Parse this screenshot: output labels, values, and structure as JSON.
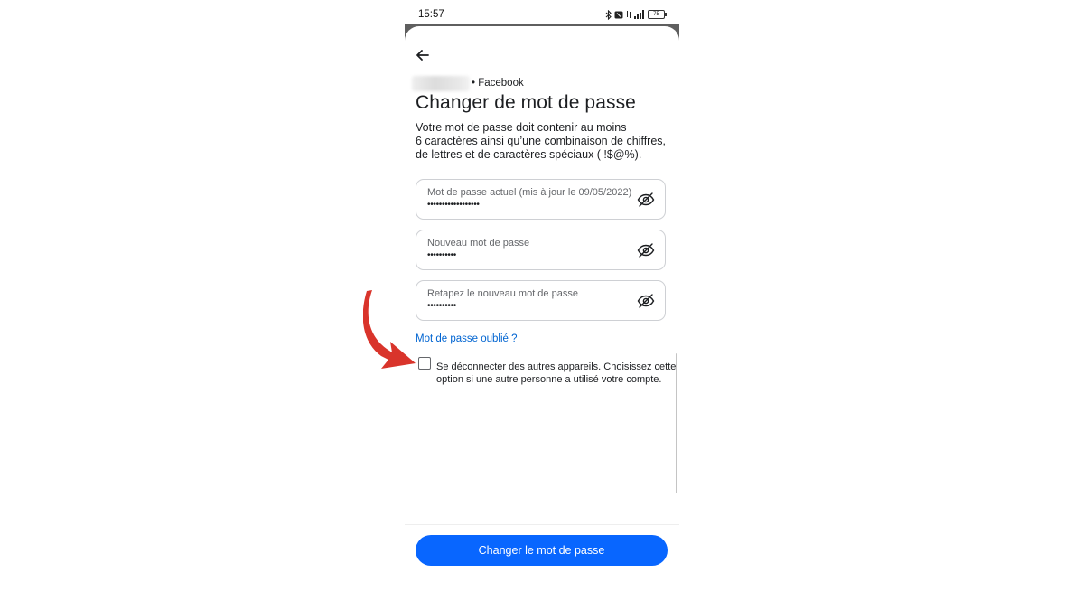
{
  "status_bar": {
    "time": "15:57",
    "battery": "75"
  },
  "header": {
    "account_suffix": "• Facebook",
    "title": "Changer de mot de passe"
  },
  "description": {
    "line1": "Votre mot de passe doit contenir au moins",
    "line2": "6 caractères ainsi qu’une combinaison de chiffres,",
    "line3": "de lettres et de caractères spéciaux ( !$@%)."
  },
  "fields": [
    {
      "label": "Mot de passe actuel (mis à jour le 09/05/2022)",
      "value": "••••••••••••••••••",
      "icon": "eye-off-icon"
    },
    {
      "label": "Nouveau mot de passe",
      "value": "••••••••••",
      "icon": "eye-off-icon"
    },
    {
      "label": "Retapez le nouveau mot de passe",
      "value": "••••••••••",
      "icon": "eye-off-icon"
    }
  ],
  "forgot_link": "Mot de passe oublié ?",
  "logout_option": {
    "checked": false,
    "line1": "Se déconnecter des autres appareils. Choisissez cette",
    "line2": "option si une autre personne a utilisé votre compte."
  },
  "submit_button": "Changer le mot de passe",
  "colors": {
    "primary": "#0866ff",
    "link": "#0064d1",
    "annotation_arrow": "#d9342b"
  }
}
